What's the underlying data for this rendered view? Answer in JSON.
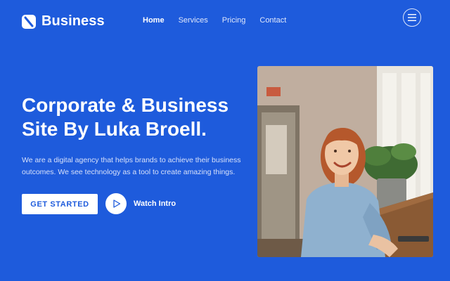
{
  "brand": {
    "name": "Business"
  },
  "nav": {
    "items": [
      {
        "label": "Home",
        "active": true
      },
      {
        "label": "Services",
        "active": false
      },
      {
        "label": "Pricing",
        "active": false
      },
      {
        "label": "Contact",
        "active": false
      }
    ]
  },
  "hero": {
    "title": "Corporate & Business Site By Luka Broell.",
    "description": "We are a digital agency that helps brands to achieve their business outcomes. We see technology as a tool to create amazing things.",
    "cta_primary": "GET STARTED",
    "cta_secondary": "Watch Intro"
  },
  "icons": {
    "logo": "logo-mark-icon",
    "menu": "hamburger-menu-icon",
    "play": "play-icon"
  },
  "colors": {
    "background": "#1e5bdc",
    "text": "#ffffff",
    "muted_text": "#d6e0fa",
    "button_bg": "#ffffff",
    "button_text": "#1e5bdc"
  }
}
